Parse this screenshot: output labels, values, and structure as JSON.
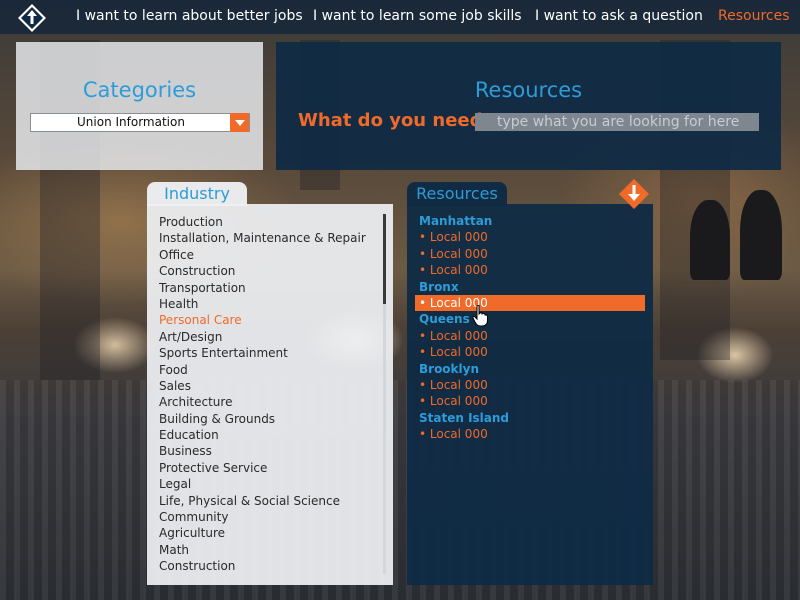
{
  "nav": {
    "logo_icon": "bulletin-arrow-logo",
    "items": [
      {
        "label": "I want to learn about better jobs",
        "active": false
      },
      {
        "label": "I want to learn some job skills",
        "active": false
      },
      {
        "label": "I want to ask a question",
        "active": false
      },
      {
        "label": "Resources",
        "active": true
      }
    ]
  },
  "categories": {
    "title": "Categories",
    "selected": "Union Information"
  },
  "search": {
    "title": "Resources",
    "label": "What do you need:",
    "placeholder": "type what you are looking for here"
  },
  "industry": {
    "tab_label": "Industry",
    "items": [
      "Production",
      "Installation, Maintenance & Repair",
      "Office",
      "Construction",
      "Transportation",
      "Health",
      "Personal Care",
      "Art/Design",
      "Sports Entertainment",
      "Food",
      "Sales",
      "Architecture",
      "Building & Grounds",
      "Education",
      "Business",
      "Protective Service",
      "Legal",
      "Life, Physical & Social Science",
      "Community",
      "Agriculture",
      "Math",
      "Construction"
    ],
    "selected_index": 6
  },
  "resources": {
    "tab_label": "Resources",
    "download_icon": "download-arrow-icon",
    "items": [
      {
        "label": "Manhattan",
        "kind": "borough"
      },
      {
        "label": "• Local 000",
        "kind": "local"
      },
      {
        "label": "• Local 000",
        "kind": "local"
      },
      {
        "label": "• Local 000",
        "kind": "local"
      },
      {
        "label": "Bronx",
        "kind": "borough"
      },
      {
        "label": "• Local 000",
        "kind": "local",
        "selected": true
      },
      {
        "label": "Queens",
        "kind": "borough"
      },
      {
        "label": "• Local 000",
        "kind": "local"
      },
      {
        "label": "• Local 000",
        "kind": "local"
      },
      {
        "label": "Brooklyn",
        "kind": "borough"
      },
      {
        "label": "• Local 000",
        "kind": "local"
      },
      {
        "label": "• Local 000",
        "kind": "local"
      },
      {
        "label": "Staten Island",
        "kind": "borough"
      },
      {
        "label": "• Local 000",
        "kind": "local"
      }
    ]
  },
  "colors": {
    "accent_orange": "#f06a2a",
    "accent_blue": "#2e9cd8",
    "panel_navy": "#0e2a44"
  }
}
